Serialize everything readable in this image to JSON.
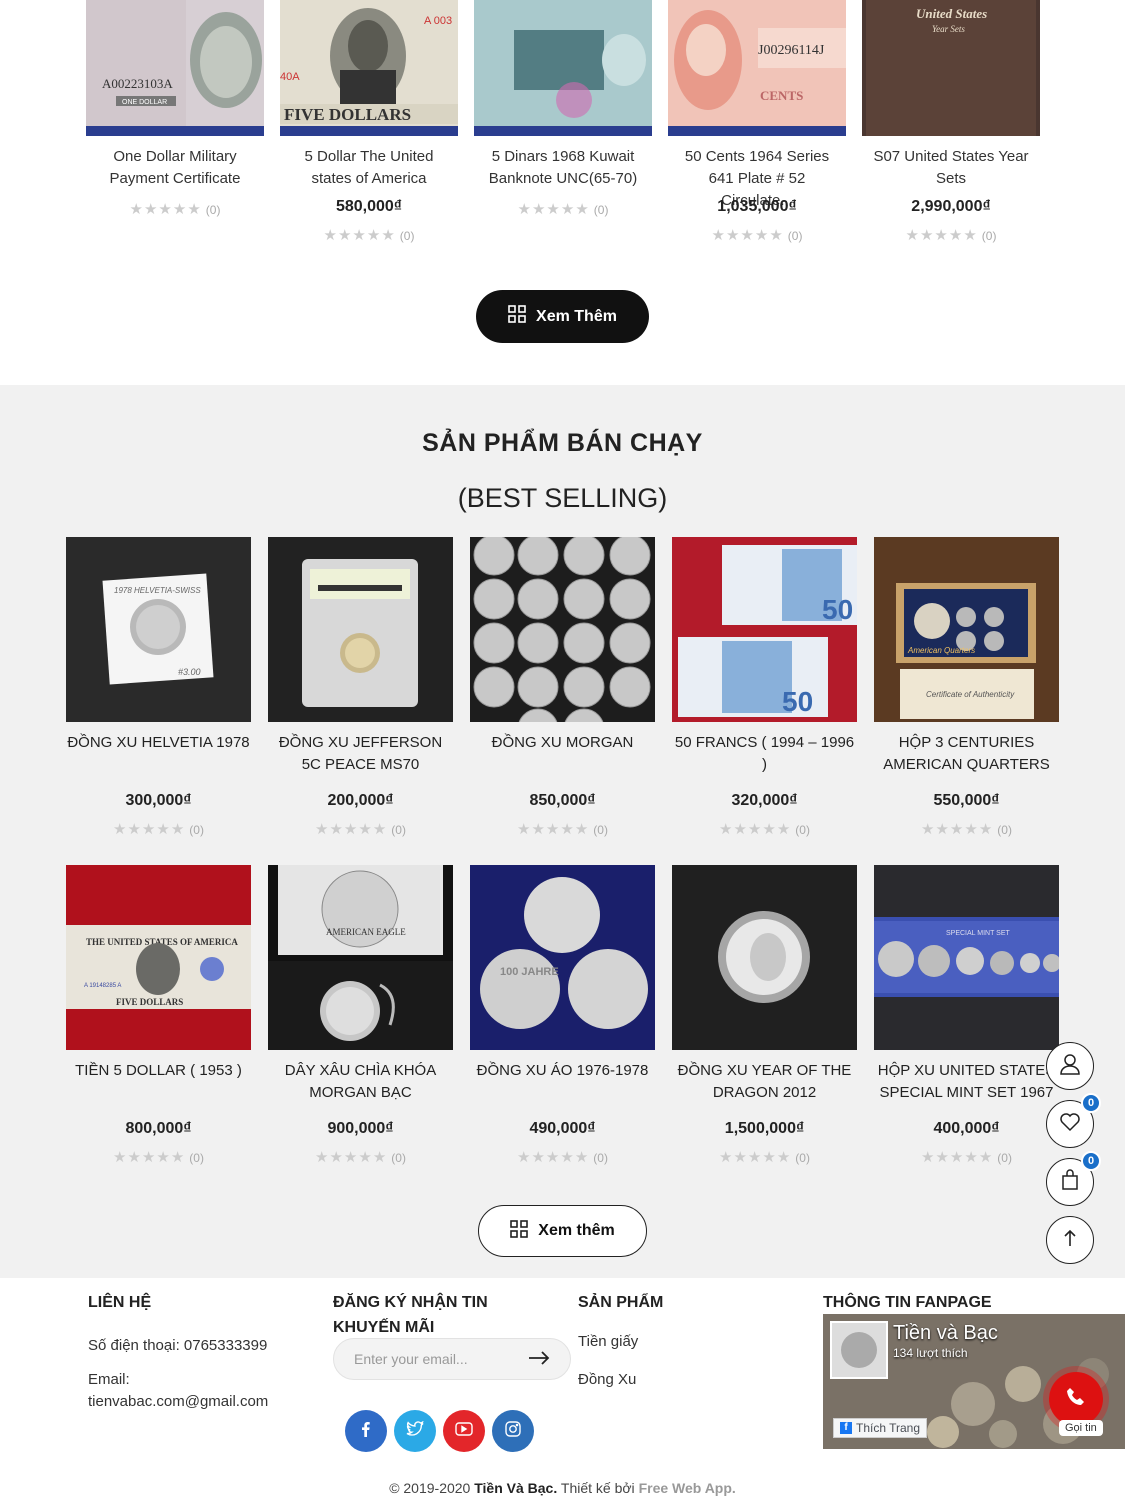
{
  "top_products": [
    {
      "name": "One Dollar Military Payment Certificate",
      "price": "",
      "rating_count": "(0)"
    },
    {
      "name": "5 Dollar The United states of America",
      "price": "580,000₫",
      "rating_count": "(0)"
    },
    {
      "name": "5 Dinars 1968 Kuwait Banknote UNC(65-70)",
      "price": "",
      "rating_count": "(0)"
    },
    {
      "name": "50 Cents 1964 Series 641 Plate # 52 Circulate...",
      "price": "1,035,000₫",
      "rating_count": "(0)"
    },
    {
      "name": "S07 United States Year Sets",
      "price": "2,990,000₫",
      "rating_count": "(0)"
    }
  ],
  "top_images": {
    "p0": {
      "serial": "A00223103A",
      "label": "ONE DOLLAR"
    },
    "p1": {
      "serial": "A 003",
      "label": "FIVE DOLLARS",
      "letters": "40A"
    },
    "p3": {
      "serial": "J00296114J",
      "label": "CENTS"
    },
    "p4": {
      "title": "United States",
      "subtitle": "Year Sets"
    }
  },
  "more_button_1": "Xem Thêm",
  "best_selling": {
    "title": "SẢN PHẨM BÁN CHẠY",
    "subtitle": "(BEST SELLING)",
    "products": [
      {
        "name": "ĐỒNG XU HELVETIA 1978",
        "price": "300,000₫",
        "rating_count": "(0)"
      },
      {
        "name": "ĐỒNG XU JEFFERSON 5C PEACE MS70",
        "price": "200,000₫",
        "rating_count": "(0)"
      },
      {
        "name": "ĐỒNG XU MORGAN",
        "price": "850,000₫",
        "rating_count": "(0)"
      },
      {
        "name": "50 FRANCS ( 1994 – 1996 )",
        "price": "320,000₫",
        "rating_count": "(0)"
      },
      {
        "name": "HỘP 3 CENTURIES AMERICAN QUARTERS",
        "price": "550,000₫",
        "rating_count": "(0)"
      },
      {
        "name": "TIỀN 5 DOLLAR ( 1953 )",
        "price": "800,000₫",
        "rating_count": "(0)"
      },
      {
        "name": "DÂY XÂU CHÌA KHÓA MORGAN BẠC",
        "price": "900,000₫",
        "rating_count": "(0)"
      },
      {
        "name": "ĐỒNG XU ÁO 1976-1978",
        "price": "490,000₫",
        "rating_count": "(0)"
      },
      {
        "name": "ĐỒNG XU YEAR OF THE DRAGON 2012",
        "price": "1,500,000₫",
        "rating_count": "(0)"
      },
      {
        "name": "HỘP XU UNITED STATES SPECIAL MINT SET 1967",
        "price": "400,000₫",
        "rating_count": "(0)"
      }
    ],
    "more_button": "Xem thêm"
  },
  "best_images": {
    "b0": {
      "note": "1978 HELVETIA-SWISS",
      "price_tag": "#3.00"
    },
    "b3": {
      "value": "50"
    },
    "b4": {
      "title": "American Quarters",
      "cert": "Certificate of Authenticity"
    },
    "b5": {
      "label": "FIVE DOLLARS",
      "top": "THE UNITED STATES OF AMERICA",
      "serial": "A 19148285 A"
    },
    "b6": {
      "label": "AMERICAN EAGLE"
    },
    "b7": {
      "label": "100 JAHRE"
    },
    "b9": {
      "label": "SPECIAL MINT SET"
    }
  },
  "floating": {
    "wishlist_count": "0",
    "cart_count": "0"
  },
  "footer": {
    "contact_title": "LIÊN HỆ",
    "phone": "Số điện thoại: 0765333399",
    "email_label": "Email:",
    "email": "tienvabac.com@gmail.com",
    "newsletter_title_1": "ĐĂNG KÝ NHẬN TIN",
    "newsletter_title_2": "KHUYẾN MÃI",
    "email_placeholder": "Enter your email...",
    "products_title": "SẢN PHẨM",
    "product_links": [
      "Tiền giấy",
      "Đồng Xu"
    ],
    "fanpage_title": "THÔNG TIN FANPAGE",
    "fanpage_name": "Tiền và Bạc",
    "fanpage_likes": "134 lượt thích",
    "fanpage_like_btn": "Thích Trang",
    "fanpage_call": "Gọi tin",
    "copyright_prefix": "© 2019-2020",
    "copyright_brand": "Tiền Và Bạc.",
    "copyright_mid": "Thiết kế bởi",
    "copyright_designer": "Free Web App."
  },
  "colors": {
    "facebook": "#2f6bc7",
    "twitter": "#2ba9e6",
    "youtube": "#e3262a",
    "instagram": "#2e6fb8",
    "badge": "#1a6fc9"
  }
}
